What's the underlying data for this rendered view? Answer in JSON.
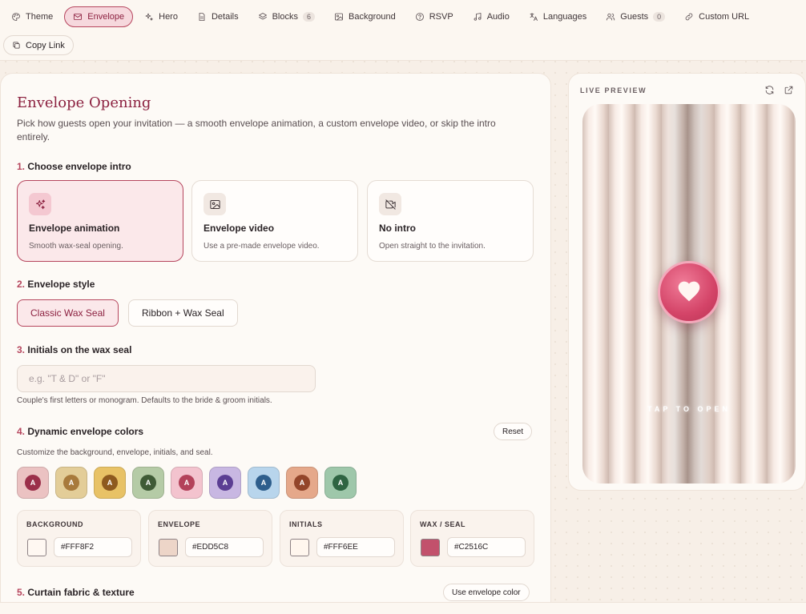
{
  "tabs": [
    {
      "label": "Theme",
      "icon": "palette-icon",
      "active": false
    },
    {
      "label": "Envelope",
      "icon": "mail-icon",
      "active": true
    },
    {
      "label": "Hero",
      "icon": "sparkles-icon",
      "active": false
    },
    {
      "label": "Details",
      "icon": "document-icon",
      "active": false
    },
    {
      "label": "Blocks",
      "icon": "layers-icon",
      "active": false,
      "badge": "6"
    },
    {
      "label": "Background",
      "icon": "image-icon",
      "active": false
    },
    {
      "label": "RSVP",
      "icon": "help-circle-icon",
      "active": false
    },
    {
      "label": "Audio",
      "icon": "music-icon",
      "active": false
    },
    {
      "label": "Languages",
      "icon": "translate-icon",
      "active": false
    },
    {
      "label": "Guests",
      "icon": "users-icon",
      "active": false,
      "badge": "0"
    },
    {
      "label": "Custom URL",
      "icon": "link-icon",
      "active": false
    }
  ],
  "copy_link": "Copy Link",
  "panel": {
    "title": "Envelope Opening",
    "description": "Pick how guests open your invitation — a smooth envelope animation, a custom envelope video, or skip the intro entirely."
  },
  "sections": {
    "intro": {
      "num": "1.",
      "title": "Choose envelope intro"
    },
    "style": {
      "num": "2.",
      "title": "Envelope style"
    },
    "initials": {
      "num": "3.",
      "title": "Initials on the wax seal"
    },
    "colors": {
      "num": "4.",
      "title": "Dynamic envelope colors"
    },
    "curtain": {
      "num": "5.",
      "title": "Curtain fabric & texture"
    }
  },
  "intro_options": [
    {
      "name": "Envelope animation",
      "desc": "Smooth wax-seal opening.",
      "icon": "sparkles-icon",
      "selected": true
    },
    {
      "name": "Envelope video",
      "desc": "Use a pre-made envelope video.",
      "icon": "image-icon",
      "selected": false
    },
    {
      "name": "No intro",
      "desc": "Open straight to the invitation.",
      "icon": "video-off-icon",
      "selected": false
    }
  ],
  "styles": [
    {
      "label": "Classic Wax Seal",
      "selected": true
    },
    {
      "label": "Ribbon + Wax Seal",
      "selected": false
    }
  ],
  "initials": {
    "placeholder": "e.g. \"T & D\" or \"F\"",
    "value": "",
    "hint": "Couple's first letters or monogram. Defaults to the bride & groom initials."
  },
  "colors": {
    "reset_label": "Reset",
    "hint": "Customize the background, envelope, initials, and seal.",
    "presets": [
      {
        "bg": "#EBC2C2",
        "dot": "#9B2F4A",
        "letter": "A"
      },
      {
        "bg": "#E3CD98",
        "dot": "#A87A3C",
        "letter": "A"
      },
      {
        "bg": "#E8C266",
        "dot": "#8E5A1F",
        "letter": "A"
      },
      {
        "bg": "#B5CBA6",
        "dot": "#3F5B36",
        "letter": "A"
      },
      {
        "bg": "#F3C3CE",
        "dot": "#B3425A",
        "letter": "A"
      },
      {
        "bg": "#C8B7E2",
        "dot": "#5B3E93",
        "letter": "A"
      },
      {
        "bg": "#B8D5EC",
        "dot": "#2E5E8C",
        "letter": "A"
      },
      {
        "bg": "#E5A88A",
        "dot": "#93452A",
        "letter": "A"
      },
      {
        "bg": "#9EC7AA",
        "dot": "#2E6442",
        "letter": "A"
      }
    ],
    "fields": [
      {
        "label": "BACKGROUND",
        "hex": "#FFF8F2"
      },
      {
        "label": "ENVELOPE",
        "hex": "#EDD5C8"
      },
      {
        "label": "INITIALS",
        "hex": "#FFF6EE"
      },
      {
        "label": "WAX / SEAL",
        "hex": "#C2516C"
      }
    ]
  },
  "curtain": {
    "use_label": "Use envelope color"
  },
  "preview": {
    "label": "LIVE PREVIEW",
    "tap_text": "TAP TO OPEN"
  }
}
